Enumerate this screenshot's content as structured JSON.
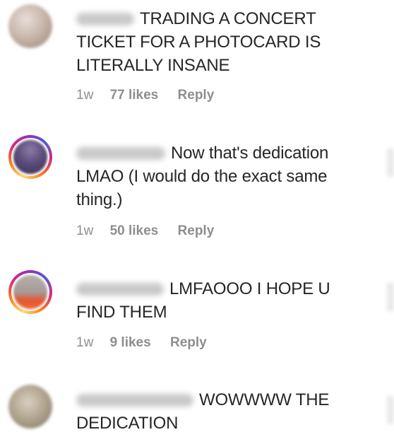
{
  "comments": [
    {
      "username": "user",
      "text_lines": [
        "TRADING A CONCERT",
        "TICKET FOR A PHOTOCARD IS",
        "LITERALLY INSANE"
      ],
      "age": "1w",
      "likes": "77 likes",
      "reply": "Reply"
    },
    {
      "username": "user",
      "text_lines": [
        "Now that's dedication",
        "LMAO (I would do the exact same",
        "thing.)"
      ],
      "age": "1w",
      "likes": "50 likes",
      "reply": "Reply"
    },
    {
      "username": "user",
      "text_lines": [
        "LMFAOOO I HOPE U",
        "FIND THEM"
      ],
      "age": "1w",
      "likes": "9 likes",
      "reply": "Reply"
    },
    {
      "username": "user",
      "text_lines": [
        "WOWWWW THE",
        "DEDICATION"
      ]
    }
  ],
  "colors": {
    "text": "#262626",
    "meta": "#8e8e8e",
    "story_ring": [
      "#feda75",
      "#fa7e1e",
      "#d62976",
      "#962fbf",
      "#4f5bd5"
    ]
  }
}
